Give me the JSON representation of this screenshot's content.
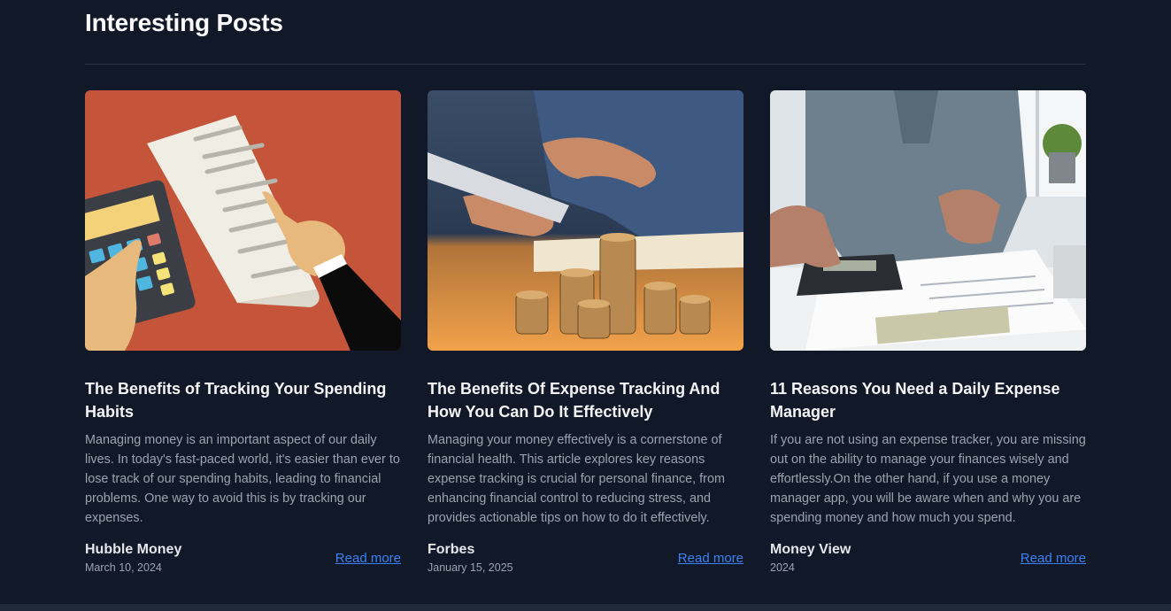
{
  "section": {
    "title": "Interesting Posts"
  },
  "posts": [
    {
      "title": "The Benefits of Tracking Your Spending Habits",
      "excerpt": "Managing money is an important aspect of our daily lives. In today's fast-paced world, it's easier than ever to lose track of our spending habits, leading to financial problems. One way to avoid this is by tracking our expenses.",
      "source": "Hubble Money",
      "date": "March 10, 2024",
      "link_label": "Read more"
    },
    {
      "title": "The Benefits Of Expense Tracking And How You Can Do It Effectively",
      "excerpt": "Managing your money effectively is a cornerstone of financial health. This article explores key reasons expense tracking is crucial for personal finance, from enhancing financial control to reducing stress, and provides actionable tips on how to do it effectively.",
      "source": "Forbes",
      "date": "January 15, 2025",
      "link_label": "Read more"
    },
    {
      "title": "11 Reasons You Need a Daily Expense Manager",
      "excerpt": "If you are not using an expense tracker, you are missing out on the ability to manage your finances wisely and effortlessly.On the other hand, if you use a money manager app, you will be aware when and why you are spending money and how much you spend.",
      "source": "Money View",
      "date": "2024",
      "link_label": "Read more"
    }
  ],
  "colors": {
    "background": "#111827",
    "link": "#3b82f6",
    "card1_bg": "#c4553a"
  }
}
